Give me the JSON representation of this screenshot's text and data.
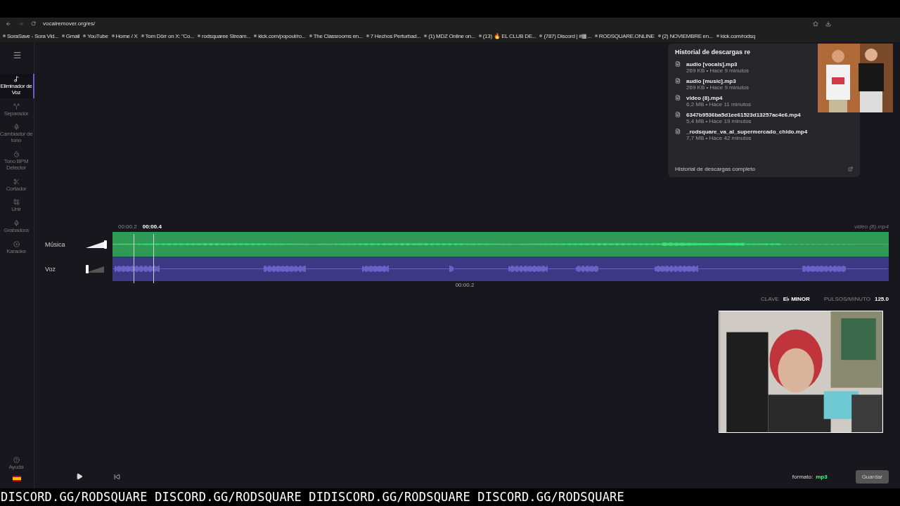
{
  "browser": {
    "address": "vocalremover.org/es/",
    "bookmarks": [
      "SoraSave - Sora Vid...",
      "Gmail",
      "YouTube",
      "Home / X",
      "Tom Dörr on X: \"Co...",
      "rodsquaree Stream...",
      "kick.com/popout/ro...",
      "The Classrooms en...",
      "7 Hechos Perturbad...",
      "(1) MDZ Online on...",
      "(13) 🔥 EL CLUB DE...",
      "(787) Discord | #▦...",
      "RODSQUARE.ONLINE",
      "(2) NOVIEMBRE en...",
      "kick.com/rodsq"
    ]
  },
  "downloads": {
    "title": "Historial de descargas re",
    "items": [
      {
        "name": "audio [vocals].mp3",
        "meta": "269 KB • Hace 9 minutos"
      },
      {
        "name": "audio [music].mp3",
        "meta": "269 KB • Hace 9 minutos"
      },
      {
        "name": "video (8).mp4",
        "meta": "6,2 MB • Hace 11 minutos"
      },
      {
        "name": "6347b9536ba5d1ee61523d13257ac4e6.mp4",
        "meta": "5,4 MB • Hace 19 minutos"
      },
      {
        "name": "_rodsquare_va_al_supermercado_chido.mp4",
        "meta": "7,7 MB • Hace 42 minutos"
      }
    ],
    "footer": "Historial de descargas completo"
  },
  "sidebar": {
    "items": [
      {
        "label": "Eliminador de Voz",
        "selected": true
      },
      {
        "label": "Separador",
        "selected": false
      },
      {
        "label": "Cambiador de tono",
        "selected": false
      },
      {
        "label": "Tono BPM Detector",
        "selected": false
      },
      {
        "label": "Cortador",
        "selected": false
      },
      {
        "label": "Unir",
        "selected": false
      },
      {
        "label": "Grabadora",
        "selected": false
      },
      {
        "label": "Karaoke",
        "selected": false
      }
    ],
    "help": "Ayuda"
  },
  "editor": {
    "times": [
      "00:00.2",
      "00:00.4"
    ],
    "file_name": "video (8).mp4",
    "position": "00:00.2",
    "tracks": [
      {
        "name": "Música",
        "kind": "music",
        "level": 1
      },
      {
        "name": "Voz",
        "kind": "voice",
        "level": 0
      }
    ],
    "key_label": "CLAVE",
    "key_value": "E♭ MINOR",
    "bpm_label": "PULSOS/MINUTO",
    "bpm_value": "125.0"
  },
  "footer": {
    "format_label": "formato:",
    "format_value": "mp3",
    "save": "Guardar"
  },
  "ticker": "DISCORD.GG/RODSQUARE DISCORD.GG/RODSQUARE DIDISCORD.GG/RODSQUARE DISCORD.GG/RODSQUARE"
}
